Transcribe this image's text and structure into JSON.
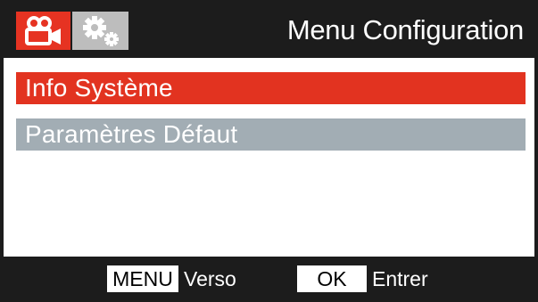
{
  "header": {
    "title": "Menu Configuration",
    "tabs": [
      {
        "icon": "video-camera-icon",
        "active": true,
        "color": "#e63322"
      },
      {
        "icon": "gears-icon",
        "active": false,
        "color": "#bdbdbd"
      }
    ]
  },
  "menu": {
    "items": [
      {
        "label": "Info Système",
        "selected": true,
        "color": "#e23320"
      },
      {
        "label": "Paramètres Défaut",
        "selected": false,
        "color": "#a2adb4"
      }
    ]
  },
  "footer": {
    "menu_key": "MENU",
    "menu_action": "Verso",
    "ok_key": "OK",
    "ok_action": "Entrer"
  },
  "colors": {
    "frame": "#1c1c1c",
    "accent": "#e23320"
  }
}
